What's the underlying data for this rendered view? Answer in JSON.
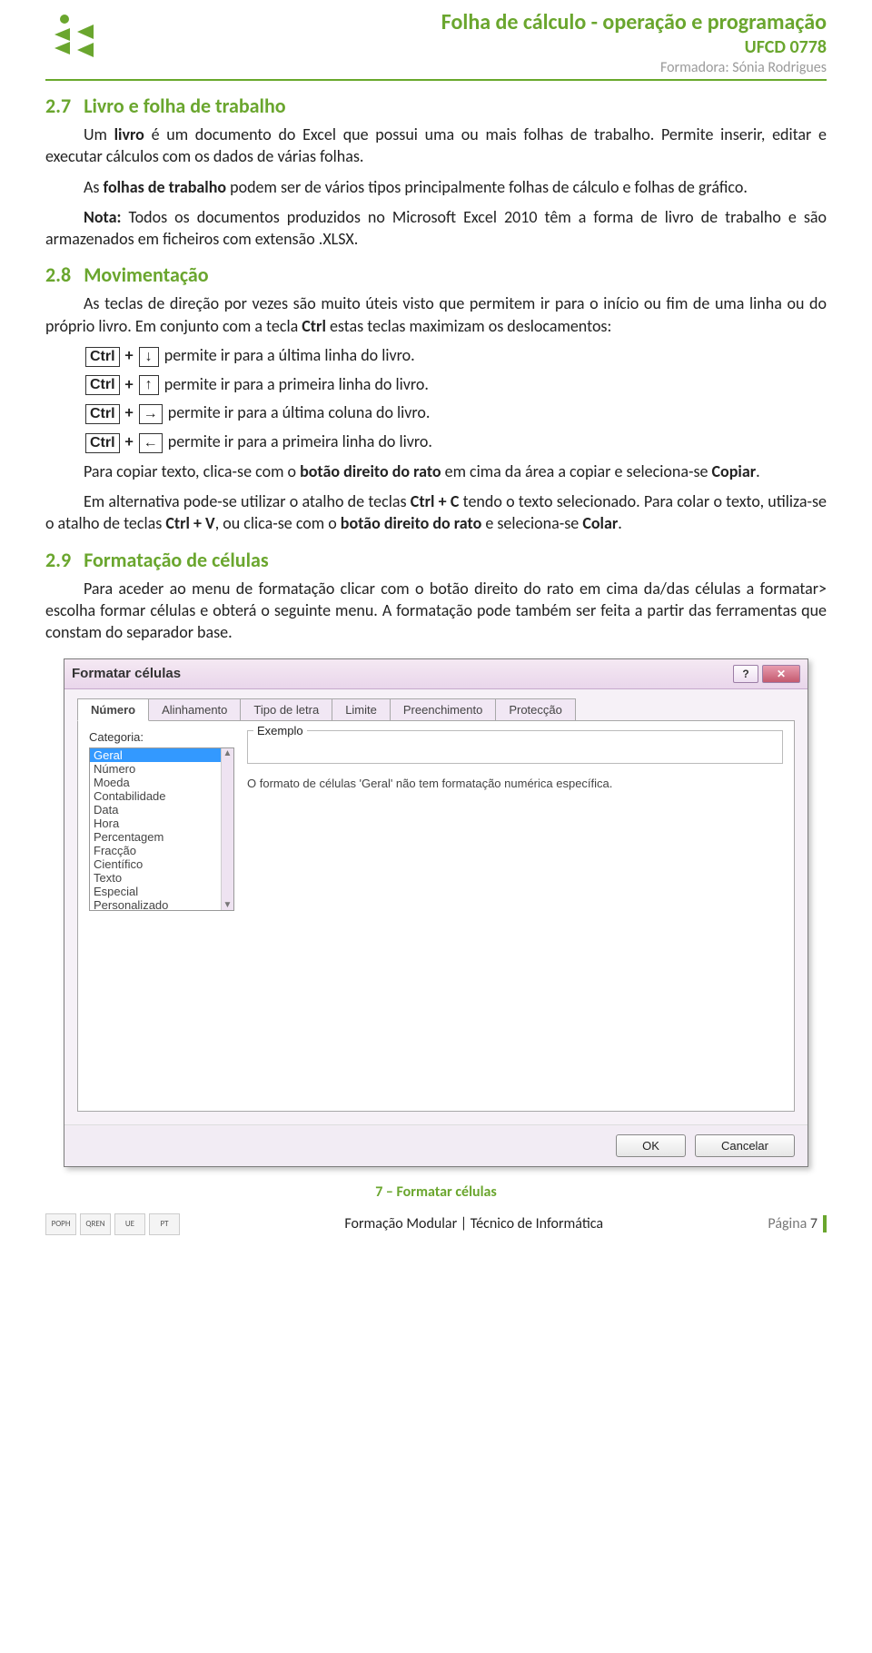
{
  "header": {
    "title": "Folha de cálculo - operação e programação",
    "ufcd": "UFCD 0778",
    "trainer": "Formadora: Sónia Rodrigues"
  },
  "sec_27": {
    "num": "2.7",
    "title": "Livro e folha de trabalho",
    "p1_pre": "Um ",
    "p1_b1": "livro",
    "p1_post": " é um documento do Excel que possui uma ou mais folhas de trabalho. Permite inserir, editar e executar cálculos com os dados de várias folhas.",
    "p2_pre": "As ",
    "p2_b1": "folhas de trabalho",
    "p2_post": " podem ser de vários tipos principalmente folhas de cálculo e folhas de gráfico.",
    "note_b": "Nota:",
    "note": " Todos os documentos produzidos no Microsoft Excel 2010 têm a forma de livro de trabalho e são armazenados em ficheiros com extensão .XLSX."
  },
  "sec_28": {
    "num": "2.8",
    "title": "Movimentação",
    "p1_a": "As teclas de direção por vezes são muito úteis visto que permitem ir para o início ou fim de uma linha ou do próprio livro. Em conjunto com a tecla ",
    "p1_b": "Ctrl",
    "p1_c": " estas teclas maximizam os deslocamentos:",
    "ctrl": "Ctrl",
    "plus": " + ",
    "k_down": "↓",
    "k_up": "↑",
    "k_right": "→",
    "k_left": "←",
    "t_down": " permite ir para a última linha do livro.",
    "t_up": " permite ir para a primeira linha do livro.",
    "t_right": " permite ir para a última coluna do livro.",
    "t_left": " permite ir para a primeira linha do livro.",
    "copy_a": "Para copiar texto, clica-se com o ",
    "copy_b": "botão direito do rato",
    "copy_c": " em cima da área a copiar e seleciona-se ",
    "copy_d": "Copiar",
    "copy_e": ".",
    "paste_a": "Em alternativa pode-se utilizar o atalho de teclas ",
    "paste_b": "Ctrl + C",
    "paste_c": " tendo o texto selecionado. Para colar o texto, utiliza-se o atalho de teclas ",
    "paste_d": "Ctrl + V",
    "paste_e": ", ou clica-se com o ",
    "paste_f": "botão direito do rato",
    "paste_g": " e seleciona-se ",
    "paste_h": "Colar",
    "paste_i": "."
  },
  "sec_29": {
    "num": "2.9",
    "title": "Formatação de células",
    "p1": "Para aceder ao menu de formatação clicar com o botão direito do rato em cima da/das células a formatar> escolha formar células e obterá o seguinte menu. A formatação pode também ser feita a partir das ferramentas que constam do separador base."
  },
  "dialog": {
    "title": "Formatar células",
    "help": "?",
    "close": "✕",
    "tabs": {
      "numero": "Número",
      "alinhamento": "Alinhamento",
      "tipo": "Tipo de letra",
      "limite": "Limite",
      "preench": "Preenchimento",
      "protec": "Protecção"
    },
    "cat_label": "Categoria:",
    "categories": [
      "Geral",
      "Número",
      "Moeda",
      "Contabilidade",
      "Data",
      "Hora",
      "Percentagem",
      "Fracção",
      "Científico",
      "Texto",
      "Especial",
      "Personalizado"
    ],
    "example_label": "Exemplo",
    "desc": "O formato de células 'Geral' não tem formatação numérica específica.",
    "scroll_up": "▲",
    "scroll_down": "▼",
    "ok": "OK",
    "cancel": "Cancelar"
  },
  "caption": "7 – Formatar células",
  "footer": {
    "center": "Formação Modular | Técnico de Informática",
    "page_label": "Página ",
    "page_num": "7",
    "badge1": "POPH",
    "badge2": "QREN",
    "badge3": "UE",
    "badge4": "PT"
  }
}
